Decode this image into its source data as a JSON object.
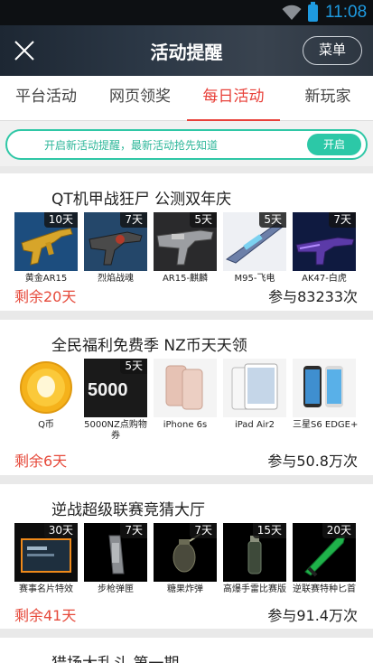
{
  "status_bar": {
    "time": "11:08"
  },
  "header": {
    "title": "活动提醒",
    "menu_label": "菜单"
  },
  "tabs": [
    {
      "label": "平台活动",
      "active": false
    },
    {
      "label": "网页领奖",
      "active": false
    },
    {
      "label": "每日活动",
      "active": true
    },
    {
      "label": "新玩家",
      "active": false
    }
  ],
  "notice": {
    "text": "开启新活动提醒，最新活动抢先知道",
    "button_label": "开启"
  },
  "activities": [
    {
      "title": "QT机甲战狂尸 公测双年庆",
      "remaining": "剩余20天",
      "participants": "参与83233次",
      "items": [
        {
          "name": "黄金AR15",
          "days": "10天"
        },
        {
          "name": "烈焰战魂",
          "days": "7天"
        },
        {
          "name": "AR15-麒麟",
          "days": "5天"
        },
        {
          "name": "M95-飞电",
          "days": "5天"
        },
        {
          "name": "AK47-白虎",
          "days": "7天"
        }
      ]
    },
    {
      "title": "全民福利免费季 NZ币天天领",
      "remaining": "剩余6天",
      "participants": "参与50.8万次",
      "items": [
        {
          "name": "Q币",
          "days": ""
        },
        {
          "name": "5000NZ点购物券",
          "days": "5天",
          "image_text": "5000"
        },
        {
          "name": "iPhone 6s",
          "days": ""
        },
        {
          "name": "iPad Air2",
          "days": ""
        },
        {
          "name": "三星S6 EDGE+",
          "days": ""
        }
      ]
    },
    {
      "title": "逆战超级联赛竞猜大厅",
      "remaining": "剩余41天",
      "participants": "参与91.4万次",
      "items": [
        {
          "name": "赛事名片特效",
          "days": "30天"
        },
        {
          "name": "步枪弹匣",
          "days": "7天"
        },
        {
          "name": "糖果炸弹",
          "days": "7天"
        },
        {
          "name": "高爆手雷比赛版",
          "days": "15天"
        },
        {
          "name": "逆联赛特种匕首",
          "days": "20天"
        }
      ]
    },
    {
      "title": "猎场大乱斗 第一期"
    }
  ],
  "colors": {
    "accent_red": "#e8413a",
    "teal": "#2cc8a7",
    "clock_blue": "#1e9ae0"
  }
}
